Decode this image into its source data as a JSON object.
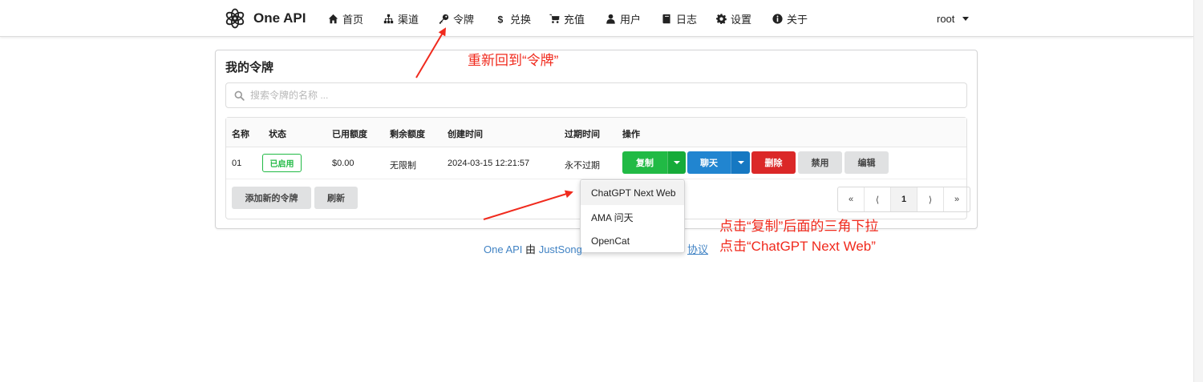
{
  "brand": {
    "name": "One API"
  },
  "nav": {
    "items": [
      {
        "label": "首页",
        "icon": "home-icon"
      },
      {
        "label": "渠道",
        "icon": "sitemap-icon"
      },
      {
        "label": "令牌",
        "icon": "key-icon"
      },
      {
        "label": "兑换",
        "icon": "dollar-icon"
      },
      {
        "label": "充值",
        "icon": "cart-icon"
      },
      {
        "label": "用户",
        "icon": "user-icon"
      },
      {
        "label": "日志",
        "icon": "book-icon"
      },
      {
        "label": "设置",
        "icon": "gear-icon"
      },
      {
        "label": "关于",
        "icon": "info-icon"
      }
    ],
    "user": "root"
  },
  "page": {
    "title": "我的令牌",
    "search_placeholder": "搜索令牌的名称 ..."
  },
  "table": {
    "headers": [
      "名称",
      "状态",
      "已用额度",
      "剩余额度",
      "创建时间",
      "过期时间",
      "操作"
    ],
    "rows": [
      {
        "name": "01",
        "status": "已启用",
        "used": "$0.00",
        "remaining": "无限制",
        "created": "2024-03-15 12:21:57",
        "expires": "永不过期"
      }
    ],
    "actions": {
      "copy": "复制",
      "chat": "聊天",
      "delete": "删除",
      "disable": "禁用",
      "edit": "编辑"
    }
  },
  "footer_buttons": {
    "add": "添加新的令牌",
    "refresh": "刷新"
  },
  "pagination": {
    "first": "«",
    "prev": "⟨",
    "current": "1",
    "next": "⟩",
    "last": "»"
  },
  "dropdown": {
    "items": [
      "ChatGPT Next Web",
      "AMA 问天",
      "OpenCat"
    ]
  },
  "footer": {
    "app": "One API",
    "by": "由",
    "author": "JustSong",
    "tail": "协议"
  },
  "annotations": {
    "nav_note": "重新回到“令牌”",
    "dropdown_note_1": "点击“复制”后面的三角下拉",
    "dropdown_note_2": "点击“ChatGPT Next Web”"
  },
  "colors": {
    "copy": "#21ba45",
    "chat": "#2185d0",
    "delete": "#db2828",
    "annotation": "#f02a1d",
    "link": "#4183c4"
  }
}
